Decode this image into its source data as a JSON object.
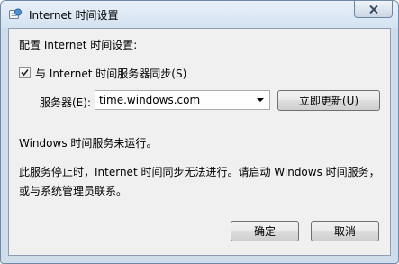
{
  "window": {
    "title": "Internet 时间设置"
  },
  "content": {
    "header": "配置 Internet 时间设置:",
    "sync_checkbox": {
      "label": "与 Internet 时间服务器同步(S)",
      "checked": true
    },
    "server": {
      "label": "服务器(E):",
      "value": "time.windows.com"
    },
    "update_now_label": "立即更新(U)",
    "status_line": "Windows 时间服务未运行。",
    "info_line1": "此服务停止时，Internet 时间同步无法进行。请启动 Windows 时间服务，",
    "info_line2": "或与系统管理员联系。"
  },
  "buttons": {
    "ok_label": "确定",
    "cancel_label": "取消"
  },
  "icons": {
    "app": "clock-globe-icon",
    "close": "close-icon",
    "check": "checkmark-icon",
    "dropdown": "chevron-down-icon"
  }
}
